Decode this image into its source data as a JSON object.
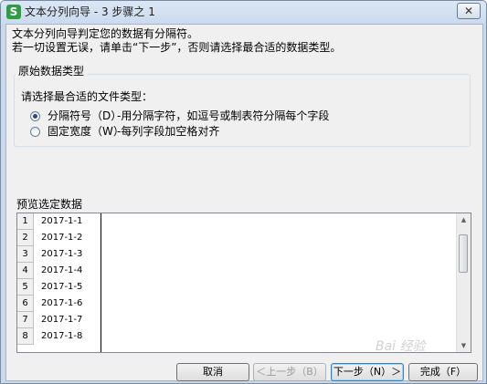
{
  "window": {
    "title": "文本分列向导 - 3 步骤之 1",
    "app_icon_letter": "S",
    "close_glyph": "✕"
  },
  "intro": {
    "line1": "文本分列向导判定您的数据有分隔符。",
    "line2": "若一切设置无误，请单击“下一步”，否则请选择最合适的数据类型。"
  },
  "original_type": {
    "group_title": "原始数据类型",
    "prompt": "请选择最合适的文件类型：",
    "options": [
      {
        "label": "分隔符号（D）",
        "desc": "-用分隔字符，如逗号或制表符分隔每个字段",
        "checked": true
      },
      {
        "label": "固定宽度（W）",
        "desc": "-每列字段加空格对齐",
        "checked": false
      }
    ]
  },
  "preview": {
    "title": "预览选定数据",
    "rows": [
      {
        "num": "1",
        "value": "2017-1-1"
      },
      {
        "num": "2",
        "value": "2017-1-2"
      },
      {
        "num": "3",
        "value": "2017-1-3"
      },
      {
        "num": "4",
        "value": "2017-1-4"
      },
      {
        "num": "5",
        "value": "2017-1-5"
      },
      {
        "num": "6",
        "value": "2017-1-6"
      },
      {
        "num": "7",
        "value": "2017-1-7"
      },
      {
        "num": "8",
        "value": "2017-1-8"
      }
    ],
    "scroll_up_glyph": "▲",
    "scroll_down_glyph": "▼"
  },
  "buttons": {
    "cancel": "取消",
    "back": "＜上一步（B）",
    "next": "下一步（N）＞",
    "finish": "完成（F）"
  },
  "watermark": "Bai 经验"
}
